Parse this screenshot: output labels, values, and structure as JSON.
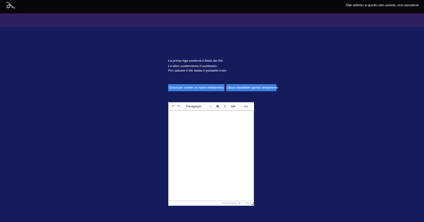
{
  "header": {
    "notice": "Stai attento a quello che carichi, non conviene"
  },
  "instructions": [
    "La prima riga conterrà il titolo del file",
    "Le altre conterranno il contenuto",
    "Per salvare il file basta il pulsante invio"
  ],
  "actions": {
    "upload_label": "Clicca per creare un nuovo testamento",
    "delete_label": "Clicca cancellare questo testamento"
  },
  "editor": {
    "block_format": "Paragraph",
    "undo_icon": "undo-icon",
    "redo_icon": "redo-icon",
    "bold_label": "B",
    "italic_label": "I",
    "text_color_icon": "text-color-icon",
    "more_icon": "more-icon",
    "powered_by": "POWERED BY TINY"
  },
  "colors": {
    "page_background": "#141c5c",
    "top_bar": "#07070a",
    "accent_bar": "#2f1f5f",
    "button": "#3d7fe0"
  }
}
